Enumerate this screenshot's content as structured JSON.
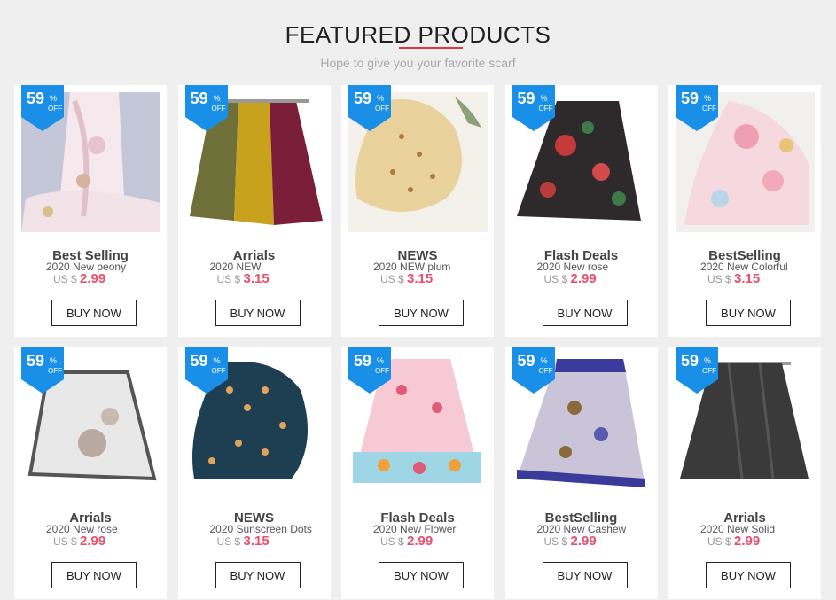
{
  "header": {
    "title": "FEATURED PRODUCTS",
    "subtitle": "Hope to give you your favorite scarf"
  },
  "colors": {
    "badge": "#1a8fe8",
    "price": "#e8506e",
    "accent": "#e0383e"
  },
  "products": [
    {
      "badge_num": "59",
      "badge_pct": "%",
      "badge_off": "OFF",
      "category": "Best Selling",
      "name": "2020 New peony",
      "currency": "US $",
      "price": "2.99",
      "button": "BUY NOW"
    },
    {
      "badge_num": "59",
      "badge_pct": "%",
      "badge_off": "OFF",
      "category": "Arrials",
      "name": "2020 NEW",
      "currency": "US $",
      "price": "3.15",
      "button": "BUY NOW"
    },
    {
      "badge_num": "59",
      "badge_pct": "%",
      "badge_off": "OFF",
      "category": "NEWS",
      "name": "2020 NEW plum",
      "currency": "US $",
      "price": "3.15",
      "button": "BUY NOW"
    },
    {
      "badge_num": "59",
      "badge_pct": "%",
      "badge_off": "OFF",
      "category": "Flash Deals",
      "name": "2020 New rose",
      "currency": "US $",
      "price": "2.99",
      "button": "BUY NOW"
    },
    {
      "badge_num": "59",
      "badge_pct": "%",
      "badge_off": "OFF",
      "category": "BestSelling",
      "name": "2020 New Colorful",
      "currency": "US $",
      "price": "3.15",
      "button": "BUY NOW"
    },
    {
      "badge_num": "59",
      "badge_pct": "%",
      "badge_off": "OFF",
      "category": "Arrials",
      "name": "2020 New rose",
      "currency": "US $",
      "price": "2.99",
      "button": "BUY NOW"
    },
    {
      "badge_num": "59",
      "badge_pct": "%",
      "badge_off": "OFF",
      "category": "NEWS",
      "name": "2020 Sunscreen Dots",
      "currency": "US $",
      "price": "3.15",
      "button": "BUY NOW"
    },
    {
      "badge_num": "59",
      "badge_pct": "%",
      "badge_off": "OFF",
      "category": "Flash Deals",
      "name": "2020 New Flower",
      "currency": "US $",
      "price": "2.99",
      "button": "BUY NOW"
    },
    {
      "badge_num": "59",
      "badge_pct": "%",
      "badge_off": "OFF",
      "category": "BestSelling",
      "name": "2020 New Cashew",
      "currency": "US $",
      "price": "2.99",
      "button": "BUY NOW"
    },
    {
      "badge_num": "59",
      "badge_pct": "%",
      "badge_off": "OFF",
      "category": "Arrials",
      "name": "2020 New Solid",
      "currency": "US $",
      "price": "2.99",
      "button": "BUY NOW"
    }
  ]
}
